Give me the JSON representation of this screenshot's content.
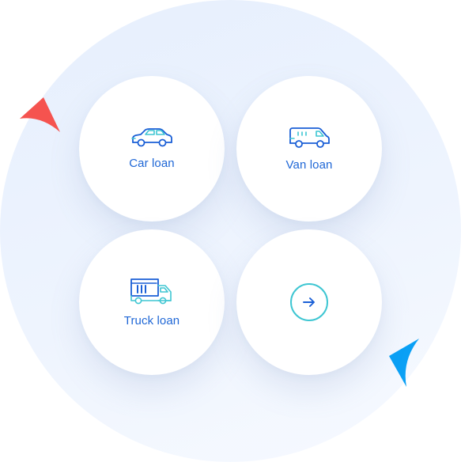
{
  "loan_options": [
    {
      "label": "Car loan",
      "icon": "car-icon"
    },
    {
      "label": "Van loan",
      "icon": "van-icon"
    },
    {
      "label": "Truck loan",
      "icon": "truck-icon"
    }
  ],
  "next": {
    "icon": "arrow-right-icon"
  },
  "colors": {
    "label": "#1f67d6",
    "icon_blue": "#1a5fd6",
    "icon_teal": "#3ec6d2",
    "decor_red": "#f5534f",
    "decor_blue": "#0aa0f5",
    "background_circle": "#e9f1fd"
  }
}
